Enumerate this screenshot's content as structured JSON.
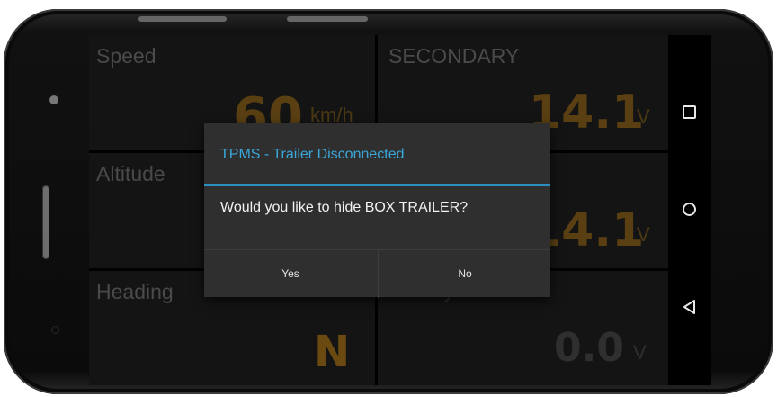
{
  "tiles": [
    {
      "title": "Speed",
      "value": "60",
      "unit": "km/h"
    },
    {
      "title": "SECONDARY",
      "value": "14.1",
      "unit": "V"
    },
    {
      "title": "Altitude",
      "value": "",
      "unit": ""
    },
    {
      "title": "",
      "value": "14.1",
      "unit": "V"
    },
    {
      "title": "Heading",
      "value": "N",
      "unit": ""
    },
    {
      "title": "Battery 3",
      "value": "0.0",
      "unit": "V"
    }
  ],
  "dialog": {
    "title": "TPMS - Trailer Disconnected",
    "message": "Would you like to hide BOX TRAILER?",
    "yes_label": "Yes",
    "no_label": "No"
  },
  "nav": {
    "recent_icon": "square-recent-apps-icon",
    "home_icon": "circle-home-icon",
    "back_icon": "triangle-back-icon"
  },
  "colors": {
    "accent": "#2c8fc0",
    "value_dimmed": "#5a3f12",
    "dialog_bg": "#2f2f2f"
  }
}
